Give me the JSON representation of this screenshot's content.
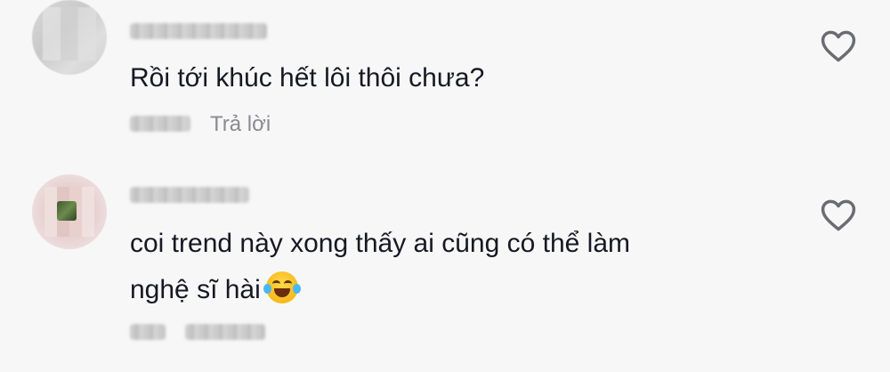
{
  "comments": [
    {
      "text_lines": [
        "Rồi tới khúc hết lôi thôi chưa?"
      ],
      "reply_label": "Trả lời"
    },
    {
      "text_lines": [
        "coi trend này xong thấy ai cũng có thể làm",
        "nghệ sĩ hài"
      ],
      "emoji": "face-with-tears-of-joy"
    }
  ],
  "icons": {
    "like": "heart-outline-icon",
    "reaction": "tears-of-joy-emoji"
  },
  "colors": {
    "background": "#f7f7f7",
    "text": "#161823",
    "secondary": "#8a8b91"
  }
}
